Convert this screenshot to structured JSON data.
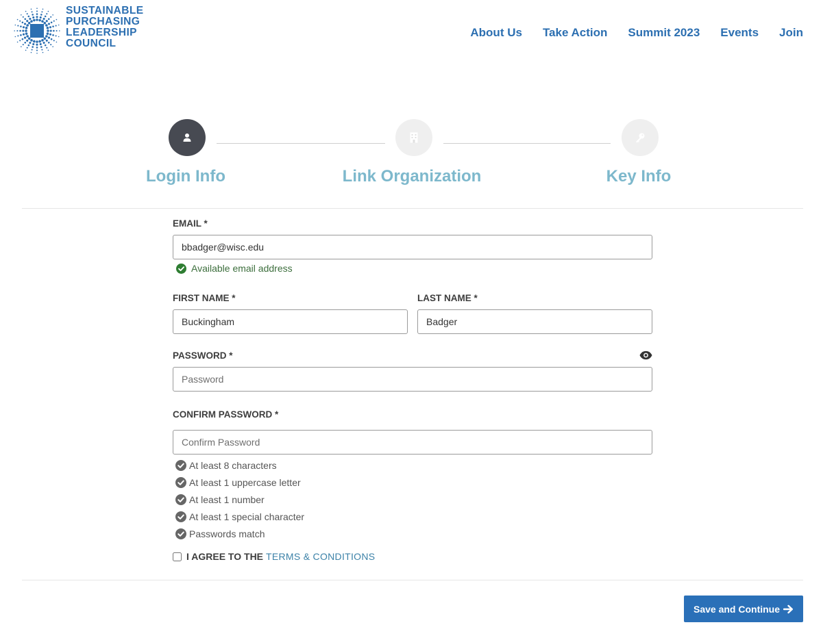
{
  "logo": {
    "lines": [
      "SUSTAINABLE",
      "PURCHASING",
      "LEADERSHIP",
      "COUNCIL"
    ]
  },
  "nav": {
    "items": [
      "About Us",
      "Take Action",
      "Summit 2023",
      "Events",
      "Join"
    ]
  },
  "stepper": {
    "steps": [
      {
        "label": "Login Info",
        "icon": "user-icon",
        "active": true
      },
      {
        "label": "Link Organization",
        "icon": "building-icon",
        "active": false
      },
      {
        "label": "Key Info",
        "icon": "key-icon",
        "active": false
      }
    ]
  },
  "form": {
    "email": {
      "label": "EMAIL *",
      "value": "bbadger@wisc.edu",
      "status": "Available email address"
    },
    "first_name": {
      "label": "FIRST NAME *",
      "value": "Buckingham"
    },
    "last_name": {
      "label": "LAST NAME *",
      "value": "Badger"
    },
    "password": {
      "label": "PASSWORD *",
      "placeholder": "Password"
    },
    "confirm_password": {
      "label": "CONFIRM PASSWORD *",
      "placeholder": "Confirm Password"
    },
    "requirements": [
      "At least 8 characters",
      "At least 1 uppercase letter",
      "At least 1 number",
      "At least 1 special character",
      "Passwords match"
    ],
    "agree": {
      "text": "I AGREE TO THE",
      "link": "TERMS & CONDITIONS"
    }
  },
  "actions": {
    "save_label": "Save and Continue"
  },
  "colors": {
    "brand_blue": "#2c6fb1",
    "step_label": "#7db8cc",
    "active_step": "#474a52",
    "success_green": "#2e7d32"
  }
}
